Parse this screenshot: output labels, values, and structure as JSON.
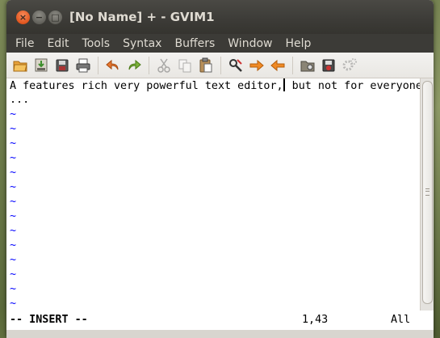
{
  "window": {
    "title": "[No Name] + - GVIM1"
  },
  "title_buttons": {
    "close": "×",
    "minimize": "−",
    "maximize": "□"
  },
  "menu": [
    "File",
    "Edit",
    "Tools",
    "Syntax",
    "Buffers",
    "Window",
    "Help"
  ],
  "toolbar": {
    "icons": [
      "open-file-icon",
      "save-icon",
      "save-all-icon",
      "print-icon",
      "undo-icon",
      "redo-icon",
      "cut-icon",
      "copy-icon",
      "paste-icon",
      "find-replace-icon",
      "find-next-icon",
      "find-previous-icon",
      "load-session-icon",
      "save-session-icon",
      "run-script-icon"
    ]
  },
  "editor": {
    "text_before_cursor": "A features rich very powerful text editor,",
    "text_after_cursor": " but not for everyone",
    "line2": "...",
    "tilde": "~",
    "empty_line_count": 14
  },
  "status": {
    "mode": "-- INSERT --",
    "position": "1,43",
    "scroll": "All"
  },
  "colors": {
    "tilde": "#0000ff",
    "titlebar": "#3c3b37",
    "close_button": "#e0561f"
  }
}
